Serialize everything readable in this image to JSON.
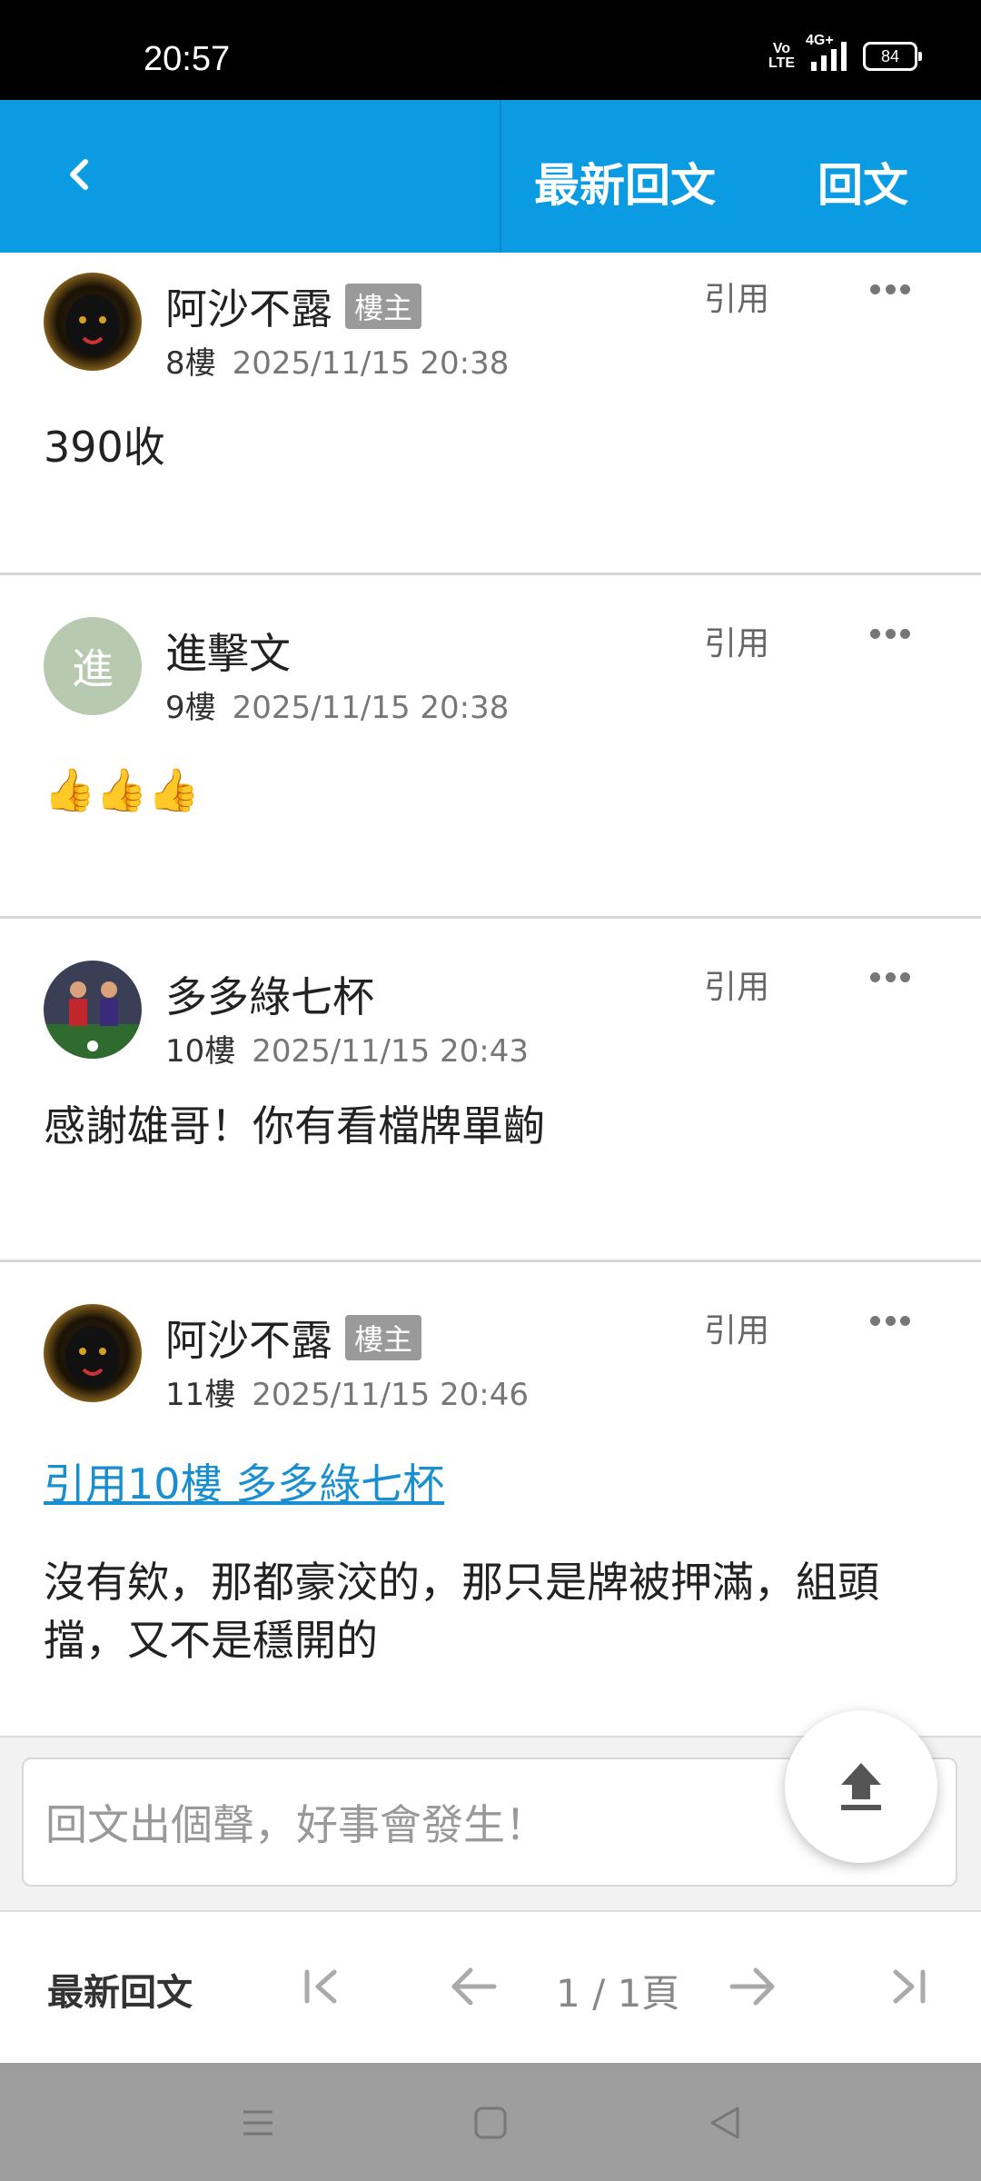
{
  "status_bar": {
    "time": "20:57",
    "volte_line1": "Vo",
    "volte_line2": "LTE",
    "network": "4G+",
    "battery": "84"
  },
  "app_bar": {
    "latest_label": "最新回文",
    "reply_label": "回文"
  },
  "posts": [
    {
      "author": "阿沙不露",
      "badge": "樓主",
      "floor": "8樓",
      "time": "2025/11/15 20:38",
      "quote_label": "引用",
      "content": "390收",
      "avatar": "panther"
    },
    {
      "author": "進擊文",
      "floor": "9樓",
      "time": "2025/11/15 20:38",
      "quote_label": "引用",
      "avatar_letter": "進",
      "content": "👍👍👍"
    },
    {
      "author": "多多綠七杯",
      "floor": "10樓",
      "time": "2025/11/15 20:43",
      "quote_label": "引用",
      "content": "感謝雄哥！你有看檔牌單齣",
      "avatar": "soccer"
    },
    {
      "author": "阿沙不露",
      "badge": "樓主",
      "floor": "11樓",
      "time": "2025/11/15 20:46",
      "quote_label": "引用",
      "quote_link": "引用10樓 多多綠七杯",
      "content": "沒有欸，那都豪洨的，那只是牌被押滿，組頭擋，又不是穩開的",
      "avatar": "panther"
    }
  ],
  "reply_box": {
    "placeholder": "回文出個聲，好事會發生！"
  },
  "pager": {
    "label": "最新回文",
    "page_info": "1 / 1頁"
  },
  "colors": {
    "app_bar": "#0a9be3",
    "link": "#1a8fd0",
    "badge": "#9a9a9a",
    "avatar_letter_bg": "#b7c9ae"
  }
}
